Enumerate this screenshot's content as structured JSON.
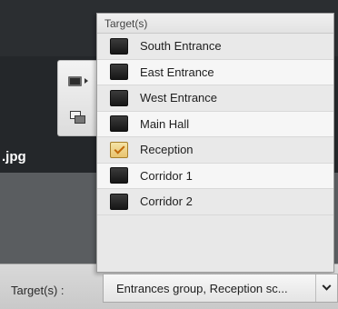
{
  "background": {
    "filename_fragment": ".jpg"
  },
  "footer": {
    "target_label": "Target(s) :",
    "select_value": "Entrances group, Reception sc..."
  },
  "toolstrip": {
    "icons": [
      "monitor-icon",
      "windows-icon"
    ]
  },
  "dropdown": {
    "header": "Target(s)",
    "items": [
      {
        "label": "South Entrance",
        "checked": false
      },
      {
        "label": "East Entrance",
        "checked": false
      },
      {
        "label": "West Entrance",
        "checked": false
      },
      {
        "label": "Main Hall",
        "checked": false
      },
      {
        "label": "Reception",
        "checked": true
      },
      {
        "label": "Corridor 1",
        "checked": false
      },
      {
        "label": "Corridor 2",
        "checked": false
      }
    ]
  },
  "colors": {
    "checked_fill": "#e8c36e",
    "checkmark": "#c26a0a"
  }
}
